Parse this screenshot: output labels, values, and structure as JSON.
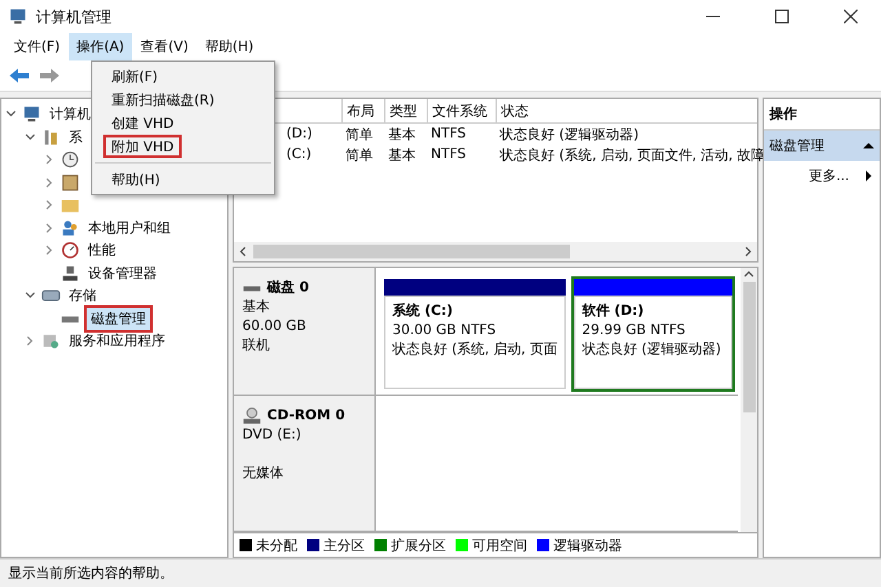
{
  "window": {
    "title": "计算机管理"
  },
  "menu_bar": [
    {
      "label": "文件(F)",
      "selected": false
    },
    {
      "label": "操作(A)",
      "selected": true
    },
    {
      "label": "查看(V)",
      "selected": false
    },
    {
      "label": "帮助(H)",
      "selected": false
    }
  ],
  "dropdown": [
    {
      "kind": "item",
      "label": "刷新(F)",
      "highlighted": false
    },
    {
      "kind": "item",
      "label": "重新扫描磁盘(R)",
      "highlighted": false
    },
    {
      "kind": "item",
      "label": "创建 VHD",
      "highlighted": false
    },
    {
      "kind": "item",
      "label": "附加 VHD",
      "highlighted": true
    },
    {
      "kind": "separator"
    },
    {
      "kind": "item",
      "label": "帮助(H)",
      "highlighted": false
    }
  ],
  "tree": [
    {
      "label": "计算机",
      "expanded": true,
      "selected": false,
      "children": [
        {
          "label": "系",
          "expanded": true,
          "selected": false,
          "children": [
            {
              "expanded": false,
              "selected": false
            },
            {
              "expanded": false,
              "selected": false
            },
            {
              "expanded": false,
              "selected": false
            },
            {
              "label": "本地用户和组",
              "expanded": false,
              "selected": false
            },
            {
              "label": "性能",
              "expanded": false,
              "selected": false
            },
            {
              "label": "设备管理器",
              "selected": false
            }
          ]
        },
        {
          "label": "存储",
          "expanded": true,
          "selected": false,
          "children": [
            {
              "label": "磁盘管理",
              "selected": true
            }
          ]
        },
        {
          "label": "服务和应用程序",
          "expanded": false,
          "selected": false
        }
      ]
    }
  ],
  "table": {
    "columns": [
      "布局",
      "类型",
      "文件系统",
      "状态"
    ],
    "rows": [
      {
        "volume": "(D:)",
        "layout": "简单",
        "type": "基本",
        "fs": "NTFS",
        "status": "状态良好 (逻辑驱动器)"
      },
      {
        "volume": "(C:)",
        "layout": "简单",
        "type": "基本",
        "fs": "NTFS",
        "status": "状态良好 (系统, 启动, 页面文件, 活动, 故障"
      }
    ]
  },
  "disks": [
    {
      "kind": "disk",
      "name": "磁盘 0",
      "lines": [
        "基本",
        "60.00 GB",
        "联机"
      ],
      "partitions": [
        {
          "label": "系统 (C:)",
          "size": "30.00 GB NTFS",
          "status": "状态良好 (系统, 启动, 页面",
          "color": "#000080",
          "selected": false
        },
        {
          "label": "软件 (D:)",
          "size": "29.99 GB NTFS",
          "status": "状态良好 (逻辑驱动器)",
          "color": "#0000ff",
          "selected": true
        }
      ]
    },
    {
      "kind": "cdrom",
      "name": "CD-ROM 0",
      "lines": [
        "DVD (E:)",
        "无媒体"
      ]
    }
  ],
  "legend": [
    {
      "label": "未分配",
      "color": "#000000"
    },
    {
      "label": "主分区",
      "color": "#000080"
    },
    {
      "label": "扩展分区",
      "color": "#008000"
    },
    {
      "label": "可用空间",
      "color": "#00ff00"
    },
    {
      "label": "逻辑驱动器",
      "color": "#0000ff"
    }
  ],
  "actions": {
    "title": "操作",
    "section": {
      "label": "磁盘管理",
      "expanded": true
    },
    "items": [
      "更多..."
    ]
  },
  "status_bar": "显示当前所选内容的帮助。"
}
